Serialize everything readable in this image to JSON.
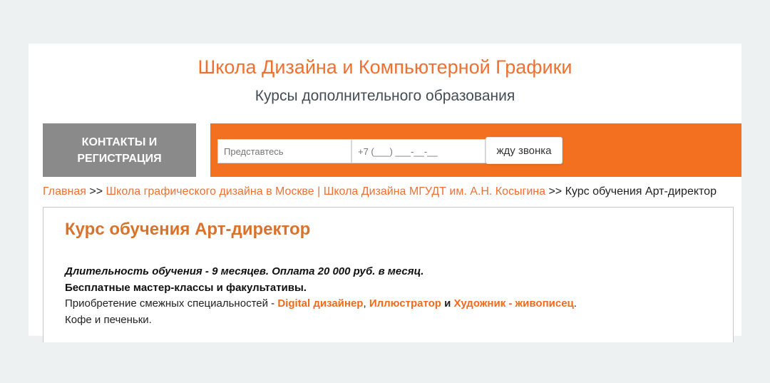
{
  "header": {
    "title": "Школа Дизайна и Компьютерной Графики",
    "subtitle": "Курсы дополнительного образования"
  },
  "nav": {
    "contacts_line1": "КОНТАКТЫ И",
    "contacts_line2": "РЕГИСТРАЦИЯ"
  },
  "callback": {
    "name_placeholder": "Представтесь",
    "phone_placeholder": "+7 (___) ___-__-__",
    "button_label": "жду звонка"
  },
  "breadcrumb": {
    "home": "Главная",
    "sep1": ">>",
    "section": "Школа графического дизайна в Москве | Школа Дизайна МГУДТ им. А.Н. Косыгина",
    "sep2": ">>",
    "current": "Курс обучения Арт-директор"
  },
  "course": {
    "title": "Курс обучения Арт-директор",
    "duration": "Длительность обучения - 9 месяцев. Оплата 20 000 руб. в месяц.",
    "free_classes": "Бесплатные мастер-классы и факультативы.",
    "related_prefix": "Приобретение смежных специальностей - ",
    "related": [
      "Digital дизайнер",
      "Иллюстратор",
      "Художник - живописец"
    ],
    "comma": ", ",
    "and": "и",
    "period": ".",
    "coffee": "Кофе и печеньки."
  },
  "colors": {
    "accent": "#f37021",
    "title": "#ef7030",
    "contacts_bg": "#8a8a8a",
    "page_bg": "#eef1f2"
  }
}
